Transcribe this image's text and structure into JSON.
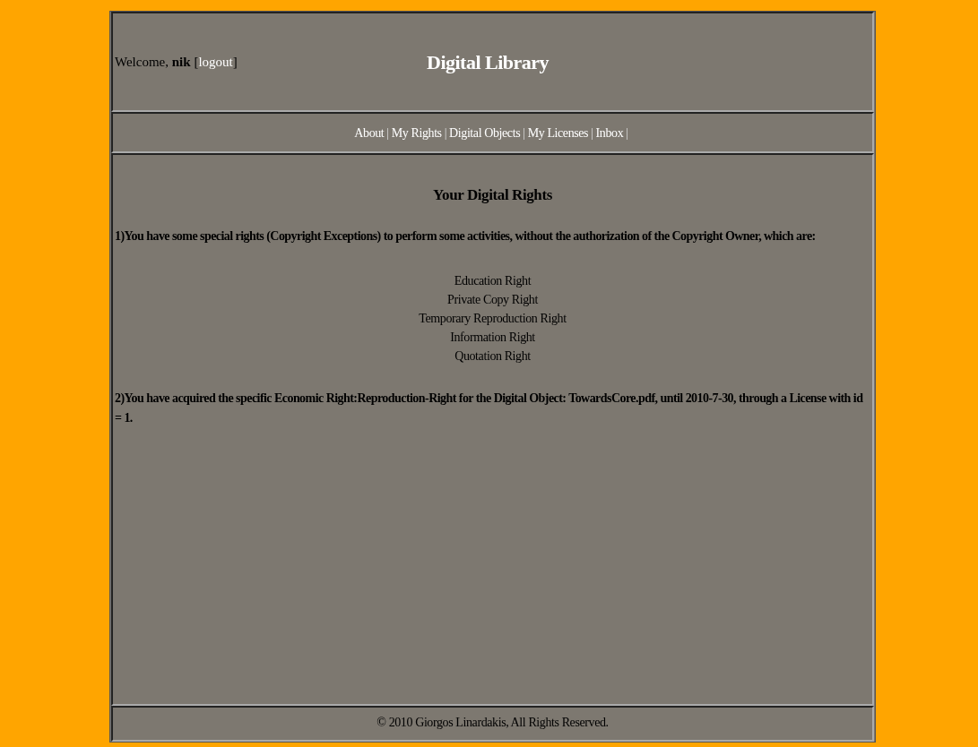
{
  "header": {
    "welcome_before": "Welcome, **nik** [",
    "logout_link": "logout",
    "welcome_after": "]",
    "title": "Digital Library"
  },
  "nav": {
    "separator": "|",
    "links": [
      {
        "label": "About"
      },
      {
        "label": "My Rights"
      },
      {
        "label": "Digital Objects"
      },
      {
        "label": "My Licenses"
      },
      {
        "label": "Inbox"
      }
    ]
  },
  "content": {
    "heading": "Your Digital Rights",
    "intro": "1)You have some special rights (Copyright Exceptions) to perform some activities, without the authorization of the Copyright Owner, which are:",
    "rights": [
      "Education Right",
      "Private Copy Right",
      "Temporary Reproduction Right",
      "Information Right",
      "Quotation Right"
    ],
    "acquired": "2)You have acquired the specific Economic Right:Reproduction-Right for the Digital Object: TowardsCore.pdf, until 2010-7-30, through a License with id = 1."
  },
  "footer": "© 2010 Giorgos Linardakis, All Rights Reserved."
}
